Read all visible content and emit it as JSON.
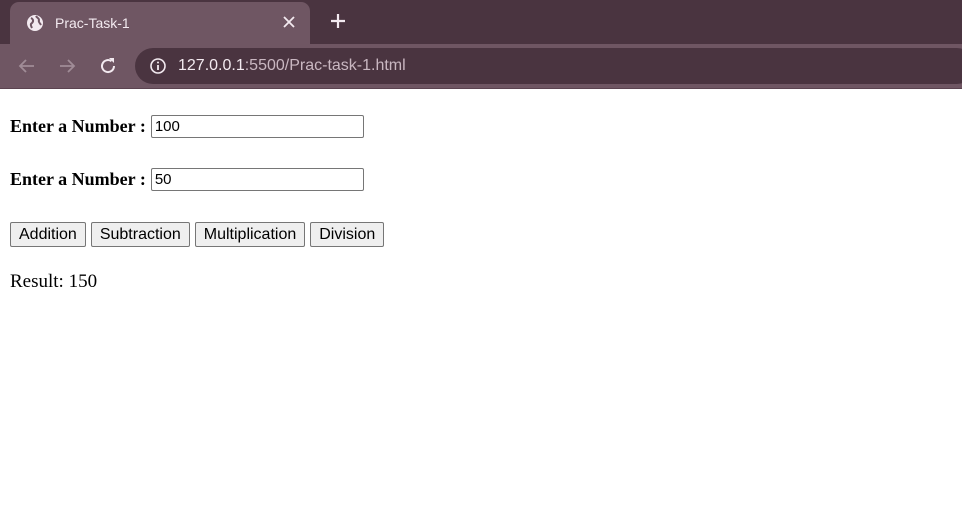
{
  "browser": {
    "tab_title": "Prac-Task-1",
    "url_host": "127.0.0.1",
    "url_rest": ":5500/Prac-task-1.html",
    "icons": {
      "favicon": "globe-icon",
      "close": "close-icon",
      "new_tab": "plus-icon",
      "back": "back-arrow-icon",
      "forward": "forward-arrow-icon",
      "reload": "reload-icon",
      "site_info": "info-icon"
    },
    "colors": {
      "tabstrip": "#4a3440",
      "toolbar": "#6f5663"
    }
  },
  "form": {
    "field1": {
      "label": "Enter a Number :",
      "value": "100"
    },
    "field2": {
      "label": "Enter a Number :",
      "value": "50"
    },
    "buttons": [
      "Addition",
      "Subtraction",
      "Multiplication",
      "Division"
    ],
    "result": "Result: 150"
  }
}
